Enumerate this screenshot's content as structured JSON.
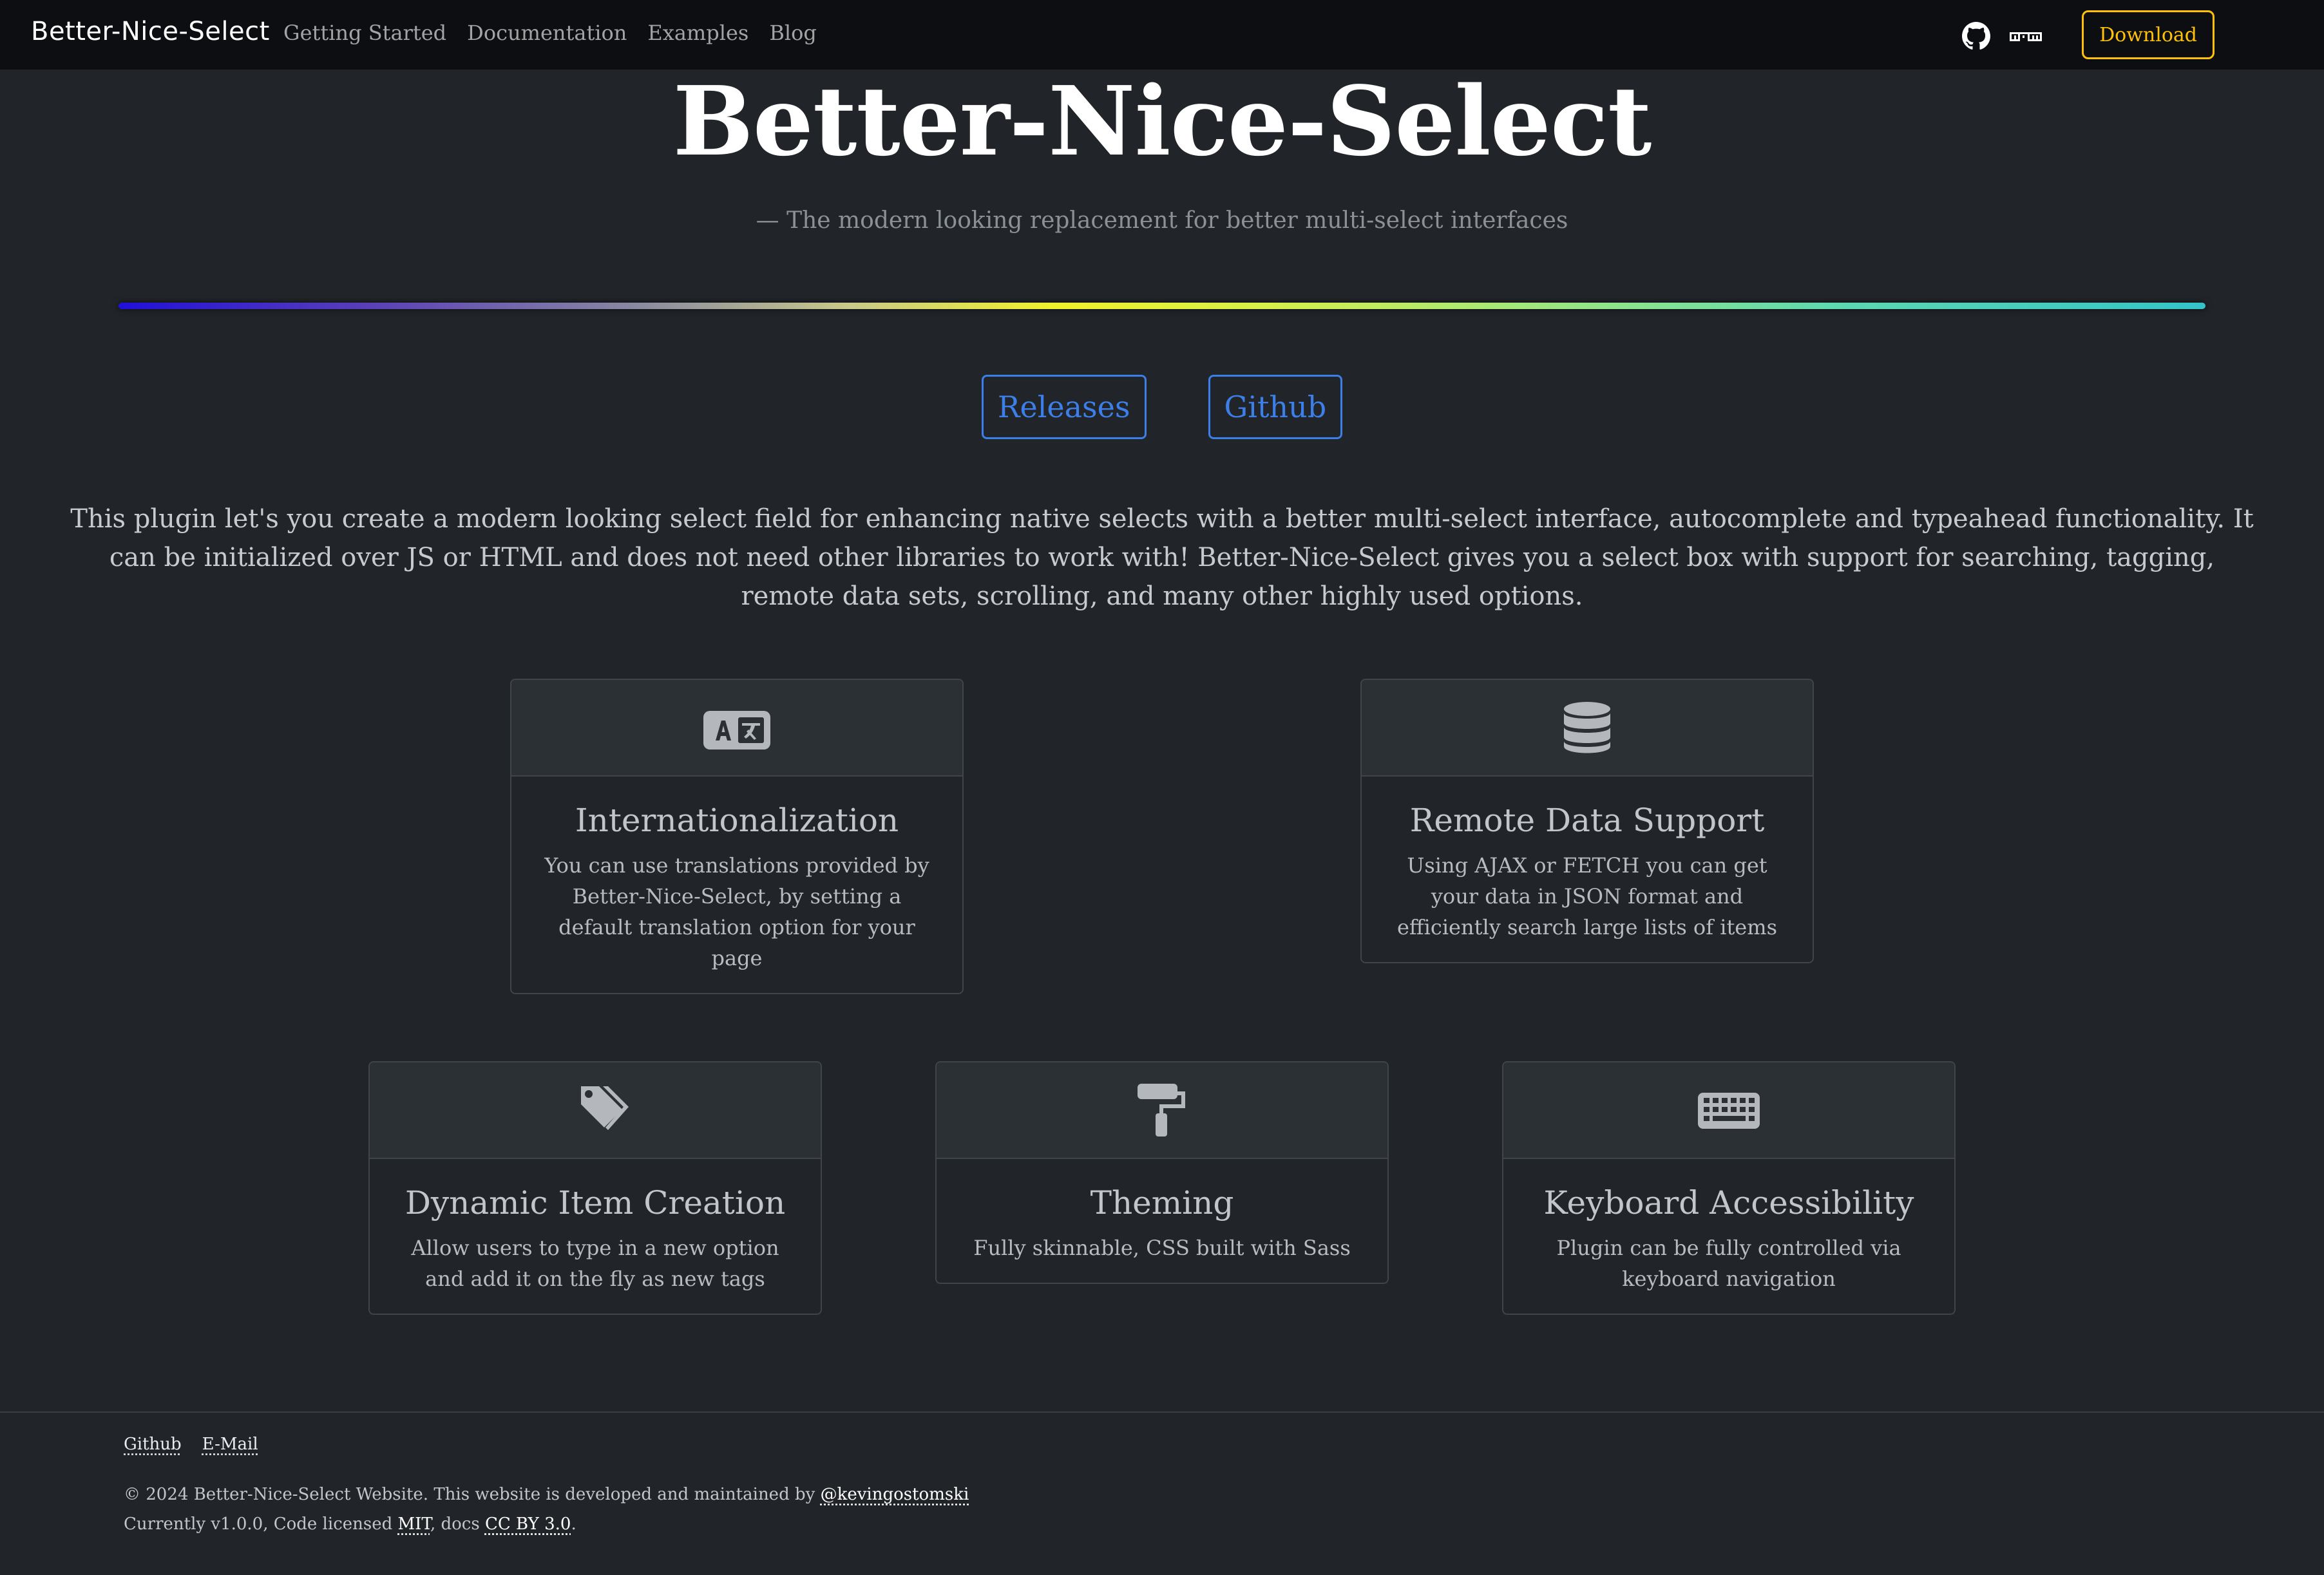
{
  "navbar": {
    "brand": "Better-Nice-Select",
    "links": [
      "Getting Started",
      "Documentation",
      "Examples",
      "Blog"
    ],
    "github_icon": "github-icon",
    "npm_icon": "npm-icon",
    "download_label": "Download"
  },
  "hero": {
    "title": "Better-Nice-Select",
    "subtitle": "— The modern looking replacement for better multi-select interfaces",
    "buttons": {
      "releases": "Releases",
      "github": "Github"
    },
    "intro": "This plugin let's you create a modern looking select field for enhancing native selects with a better multi-select interface, autocomplete and typeahead functionality. It can be initialized over JS or HTML and does not need other libraries to work with! Better-Nice-Select gives you a select box with support for searching, tagging, remote data sets, scrolling, and many other highly used options."
  },
  "features": [
    {
      "icon": "translate-icon",
      "title": "Internationalization",
      "text": "You can use translations provided by Better-Nice-Select, by setting a default translation option for your page"
    },
    {
      "icon": "database-icon",
      "title": "Remote Data Support",
      "text": "Using AJAX or FETCH you can get your data in JSON format and efficiently search large lists of items"
    },
    {
      "icon": "tags-icon",
      "title": "Dynamic Item Creation",
      "text": "Allow users to type in a new option and add it on the fly as new tags"
    },
    {
      "icon": "paint-roller-icon",
      "title": "Theming",
      "text": "Fully skinnable, CSS built with Sass"
    },
    {
      "icon": "keyboard-icon",
      "title": "Keyboard Accessibility",
      "text": "Plugin can be fully controlled via keyboard navigation"
    }
  ],
  "footer": {
    "links": [
      "Github",
      "E-Mail"
    ],
    "copyright_prefix": "© 2024 Better-Nice-Select Website. This website is developed and maintained by ",
    "author": "@kevingostomski",
    "license_prefix": "Currently v1.0.0, Code licensed ",
    "license_mit": "MIT",
    "license_mid": ", docs ",
    "license_cc": "CC BY 3.0",
    "license_suffix": "."
  },
  "colors": {
    "background": "#212529",
    "navbar": "#0d0e11",
    "accent_blue": "#3d7fe8",
    "accent_yellow": "#ffc107"
  }
}
